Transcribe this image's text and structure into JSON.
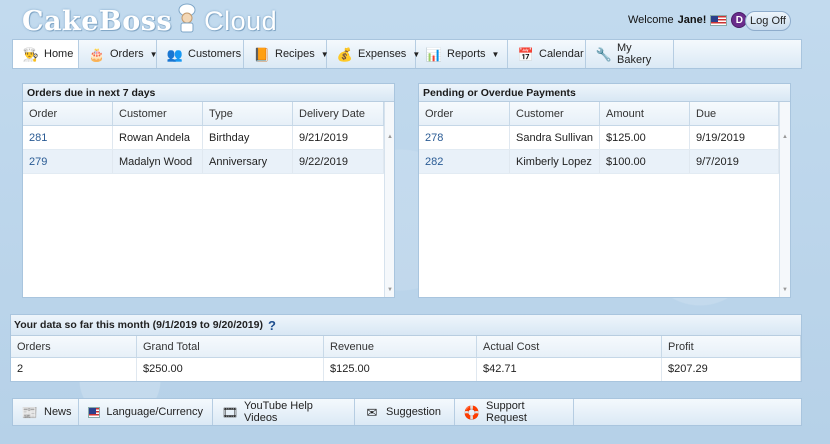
{
  "header": {
    "logo_main": "CakeBoss",
    "logo_sub": "Cloud",
    "welcome_prefix": "Welcome ",
    "user_name": "Jane!",
    "avatar_letter": "D",
    "logoff_label": "Log Off"
  },
  "nav": [
    {
      "label": "Home",
      "icon": "chef-hat-icon",
      "glyph": "👨‍🍳",
      "dropdown": false,
      "active": true
    },
    {
      "label": "Orders",
      "icon": "cake-icon",
      "glyph": "🎂",
      "dropdown": true
    },
    {
      "label": "Customers",
      "icon": "customers-icon",
      "glyph": "👥",
      "dropdown": false
    },
    {
      "label": "Recipes",
      "icon": "recipe-book-icon",
      "glyph": "📙",
      "dropdown": true
    },
    {
      "label": "Expenses",
      "icon": "money-icon",
      "glyph": "💰",
      "dropdown": true
    },
    {
      "label": "Reports",
      "icon": "pie-chart-icon",
      "glyph": "📊",
      "dropdown": true
    },
    {
      "label": "Calendar",
      "icon": "calendar-icon",
      "glyph": "📅",
      "dropdown": false
    },
    {
      "label": "My Bakery",
      "icon": "tools-icon",
      "glyph": "🔧",
      "dropdown": false
    }
  ],
  "orders_due": {
    "title": "Orders due in next 7 days",
    "columns": [
      "Order",
      "Customer",
      "Type",
      "Delivery Date"
    ],
    "rows": [
      [
        "281",
        "Rowan Andela",
        "Birthday",
        "9/21/2019"
      ],
      [
        "279",
        "Madalyn Wood",
        "Anniversary",
        "9/22/2019"
      ]
    ]
  },
  "payments": {
    "title": "Pending or Overdue Payments",
    "columns": [
      "Order",
      "Customer",
      "Amount",
      "Due"
    ],
    "rows": [
      [
        "278",
        "Sandra Sullivan",
        "$125.00",
        "9/19/2019"
      ],
      [
        "282",
        "Kimberly Lopez",
        "$100.00",
        "9/7/2019"
      ]
    ]
  },
  "month_stats": {
    "title": "Your data so far this month (9/1/2019 to 9/20/2019)",
    "help_glyph": "?",
    "columns": [
      "Orders",
      "Grand Total",
      "Revenue",
      "Actual Cost",
      "Profit"
    ],
    "values": [
      "2",
      "$250.00",
      "$125.00",
      "$42.71",
      "$207.29"
    ]
  },
  "footer": [
    {
      "label": "News",
      "icon": "newspaper-icon",
      "glyph": "📰"
    },
    {
      "label": "Language/Currency",
      "icon": "us-flag-icon",
      "glyph": ""
    },
    {
      "label": "YouTube Help Videos",
      "icon": "film-reel-icon",
      "glyph": "🎞"
    },
    {
      "label": "Suggestion",
      "icon": "envelope-icon",
      "glyph": "✉"
    },
    {
      "label": "Support Request",
      "icon": "lifebuoy-icon",
      "glyph": "🛟"
    }
  ],
  "colors": {
    "background": "#b9d4ea",
    "link": "#2a5b94",
    "panel_border": "#a9c5de"
  }
}
